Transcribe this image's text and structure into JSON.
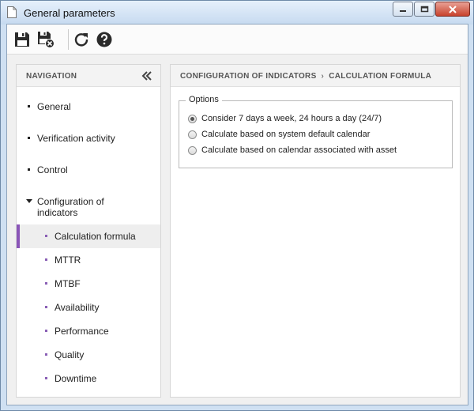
{
  "window": {
    "title": "General parameters",
    "buttons": {
      "minimize": "minimize",
      "maximize": "maximize",
      "close": "close"
    }
  },
  "toolbar": {
    "items": [
      {
        "name": "save",
        "icon": "floppy-disk-icon"
      },
      {
        "name": "save-and-close",
        "icon": "floppy-disk-close-icon"
      },
      {
        "name": "refresh",
        "icon": "refresh-icon"
      },
      {
        "name": "help",
        "icon": "help-icon"
      }
    ]
  },
  "navigation": {
    "header": "NAVIGATION",
    "collapse_icon": "double-chevron-left-icon",
    "items": [
      {
        "label": "General",
        "level": 1
      },
      {
        "label": "Verification activity",
        "level": 1
      },
      {
        "label": "Control",
        "level": 1
      },
      {
        "label": "Configuration of indicators",
        "level": 1,
        "expanded": true
      },
      {
        "label": "Calculation formula",
        "level": 2,
        "selected": true
      },
      {
        "label": "MTTR",
        "level": 2
      },
      {
        "label": "MTBF",
        "level": 2
      },
      {
        "label": "Availability",
        "level": 2
      },
      {
        "label": "Performance",
        "level": 2
      },
      {
        "label": "Quality",
        "level": 2
      },
      {
        "label": "Downtime",
        "level": 2
      }
    ],
    "accent_color": "#8a55b8"
  },
  "content": {
    "breadcrumb": [
      "CONFIGURATION OF INDICATORS",
      "CALCULATION FORMULA"
    ],
    "breadcrumb_separator": "›",
    "options": {
      "legend": "Options",
      "choices": [
        {
          "label": "Consider 7 days a week, 24 hours a day (24/7)",
          "checked": true
        },
        {
          "label": "Calculate based on system default calendar",
          "checked": false
        },
        {
          "label": "Calculate based on calendar associated with asset",
          "checked": false
        }
      ]
    }
  }
}
